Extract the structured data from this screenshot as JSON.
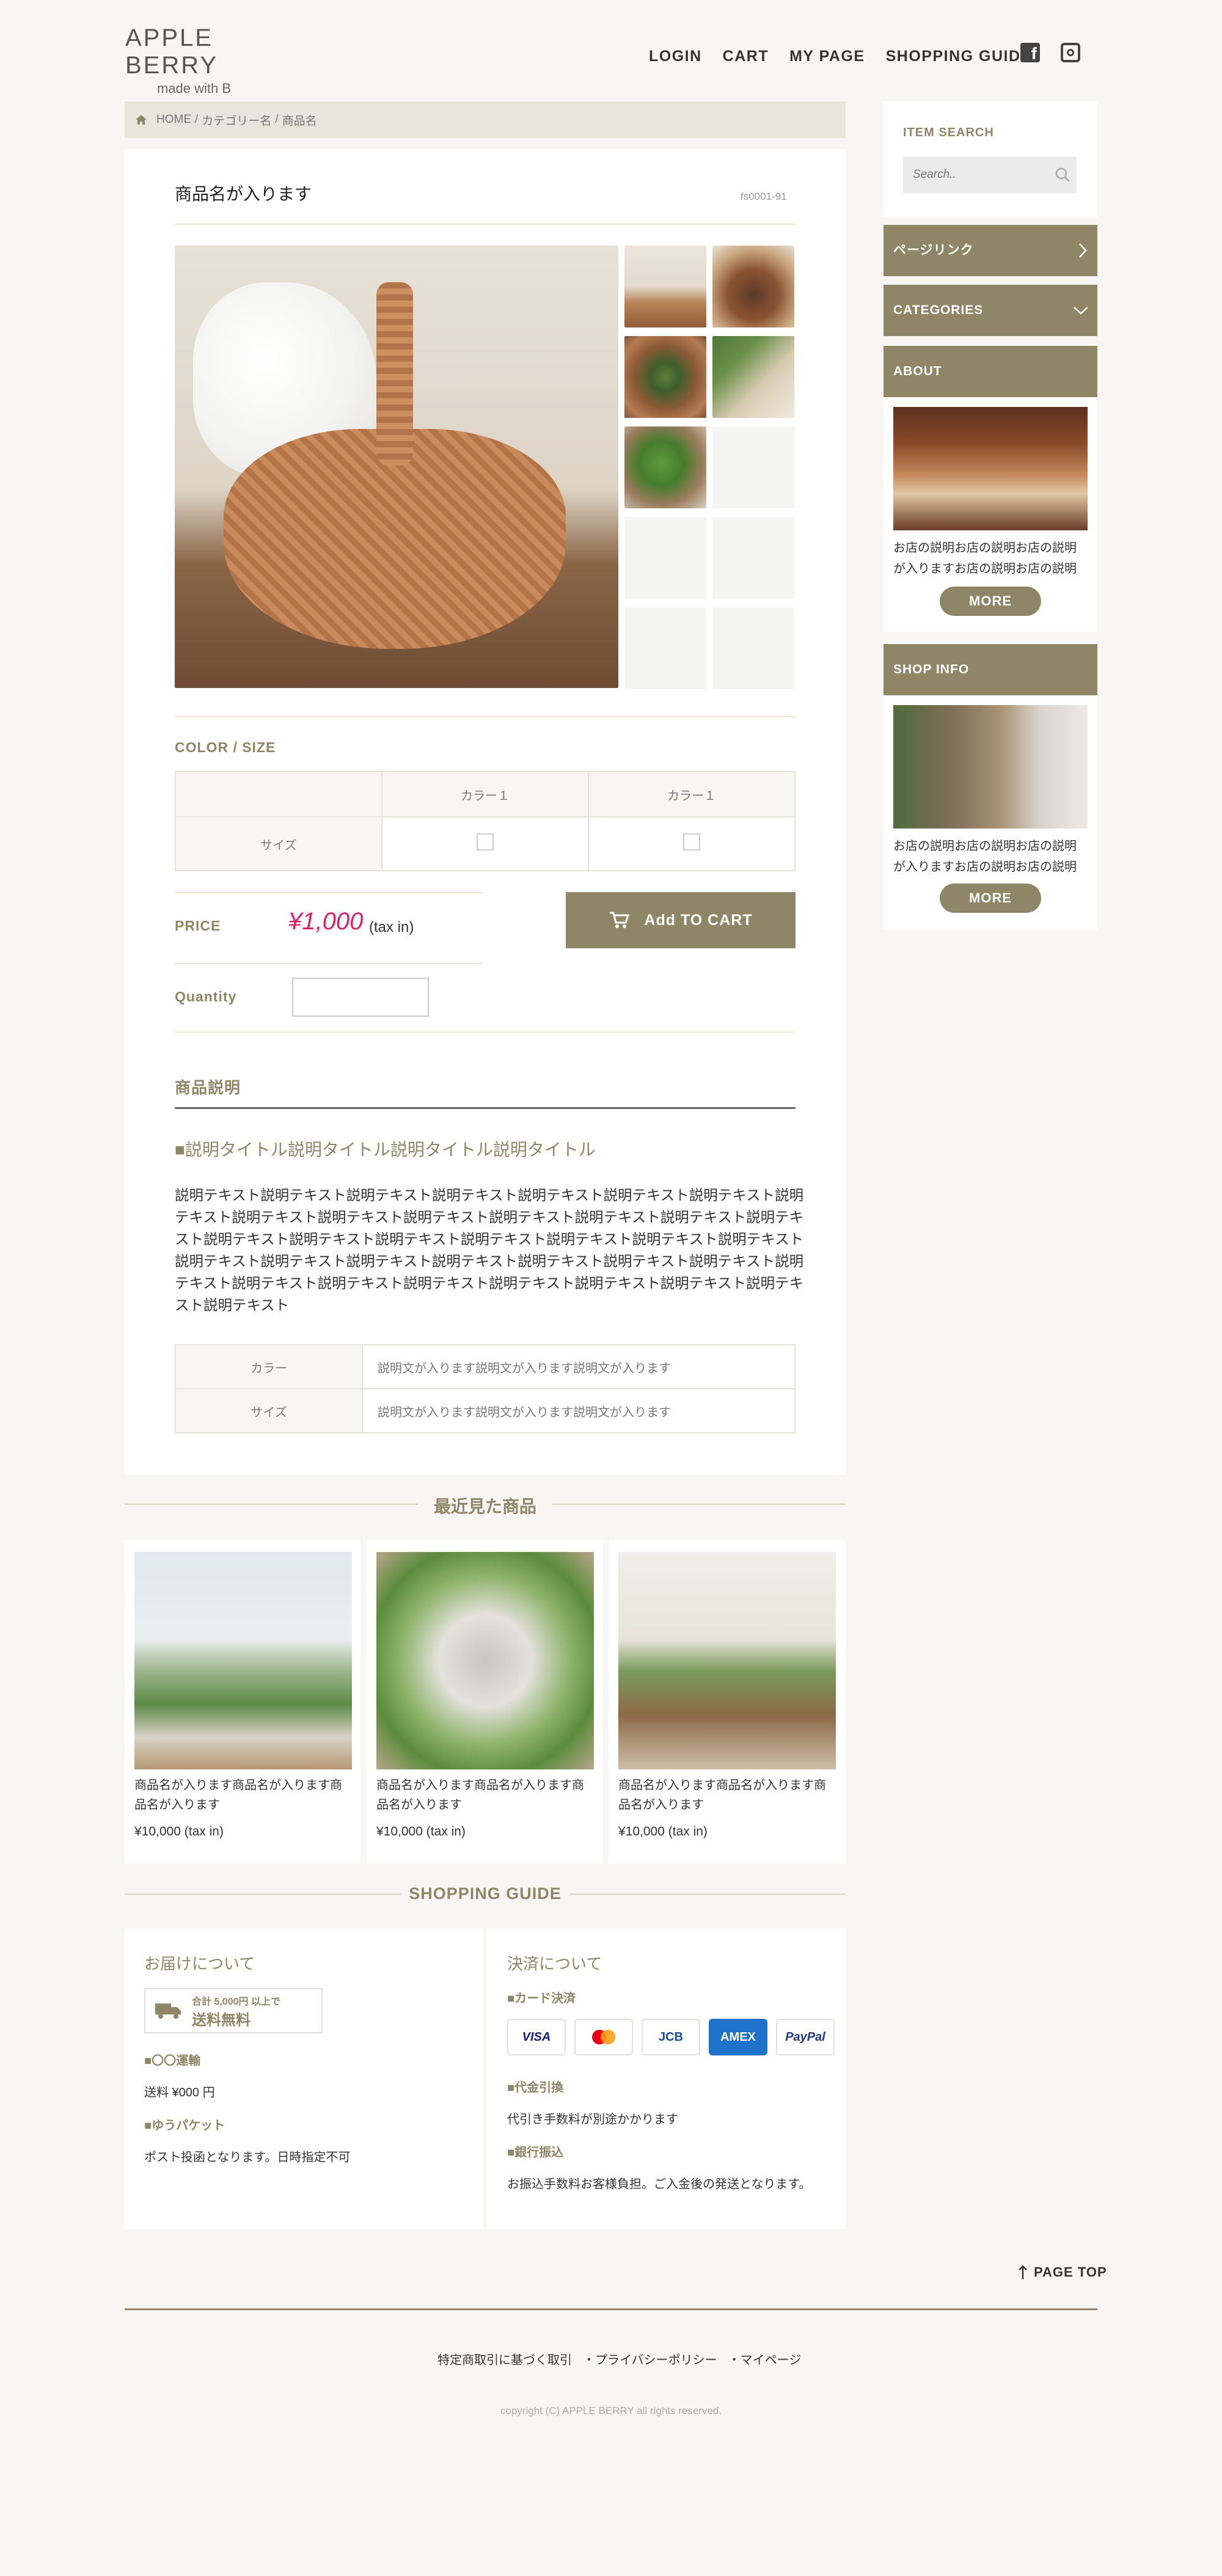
{
  "header": {
    "logo_title": "APPLE BERRY",
    "logo_sub": "made with B",
    "nav": [
      "LOGIN",
      "CART",
      "MY PAGE",
      "SHOPPING GUIDE"
    ]
  },
  "breadcrumb": {
    "home": "HOME",
    "sep1": "/",
    "category": "カテゴリー名",
    "sep2": "/",
    "current": "商品名"
  },
  "product": {
    "name": "商品名が入ります",
    "code": "fs0001-91",
    "color_size_heading": "COLOR / SIZE",
    "col1": "カラー１",
    "col2": "カラー１",
    "row_label": "サイズ",
    "price_label": "PRICE",
    "price_value": "¥1,000",
    "price_tax": "(tax in)",
    "add_to_cart": "Add TO CART",
    "quantity_label": "Quantity",
    "quantity_value": "",
    "desc_heading": "商品説明",
    "desc_title": "■説明タイトル説明タイトル説明タイトル説明タイトル",
    "desc_lines": [
      "説明テキスト説明テキスト説明テキスト説明テキスト説明テキスト説明テキスト説明テキスト説明",
      "テキスト説明テキスト説明テキスト説明テキスト説明テキスト説明テキスト説明テキスト説明テキ",
      "スト説明テキスト説明テキスト説明テキスト説明テキスト説明テキスト説明テキスト説明テキスト",
      "説明テキスト説明テキスト説明テキスト説明テキスト説明テキスト説明テキスト説明テキスト説明",
      "テキスト説明テキスト説明テキスト説明テキスト説明テキスト説明テキスト説明テキスト説明テキ",
      "スト説明テキスト"
    ],
    "spec": [
      {
        "label": "カラー",
        "value": "説明文が入ります説明文が入ります説明文が入ります"
      },
      {
        "label": "サイズ",
        "value": "説明文が入ります説明文が入ります説明文が入ります"
      }
    ]
  },
  "recent": {
    "heading": "最近見た商品",
    "items": [
      {
        "name": "商品名が入ります商品名が入ります商品名が入ります",
        "price": "¥10,000 (tax in)"
      },
      {
        "name": "商品名が入ります商品名が入ります商品名が入ります",
        "price": "¥10,000 (tax in)"
      },
      {
        "name": "商品名が入ります商品名が入ります商品名が入ります",
        "price": "¥10,000 (tax in)"
      }
    ]
  },
  "guide": {
    "heading": "SHOPPING GUIDE",
    "delivery_title": "お届けについて",
    "free_ship_small": "合計 5,000円 以上で",
    "free_ship_big": "送料無料",
    "carrier_title": "■〇〇運輸",
    "carrier_text": "送料 ¥000 円",
    "packet_title": "■ゆうパケット",
    "packet_text": "ポスト投函となります。日時指定不可",
    "payment_title": "決済について",
    "card_title": "■カード決済",
    "cards": [
      "VISA",
      "MasterCard",
      "JCB",
      "AMEX",
      "PayPal"
    ],
    "cod_title": "■代金引換",
    "cod_text": "代引き手数料が別途かかります",
    "bank_title": "■銀行振込",
    "bank_text": "お振込手数料お客様負担。ご入金後の発送となります。"
  },
  "sidebar": {
    "search_heading": "ITEM SEARCH",
    "search_placeholder": "Search..",
    "page_link": "ページリンク",
    "categories": "CATEGORIES",
    "about": "ABOUT",
    "about_text1": "お店の説明お店の説明お店の説明",
    "about_text2": "が入りますお店の説明お店の説明",
    "about_more": "MORE",
    "shop_info": "SHOP INFO",
    "shop_text1": "お店の説明お店の説明お店の説明",
    "shop_text2": "が入りますお店の説明お店の説明",
    "shop_more": "MORE"
  },
  "footer": {
    "page_top": "PAGE TOP",
    "links": [
      "特定商取引に基づく取引",
      "・プライバシーポリシー",
      "・マイページ"
    ],
    "copyright": "copyright (C) APPLE BERRY all rights reserved."
  },
  "colors": {
    "accent": "#8e8667",
    "price": "#d6246e",
    "bg": "#f7f6f4"
  }
}
